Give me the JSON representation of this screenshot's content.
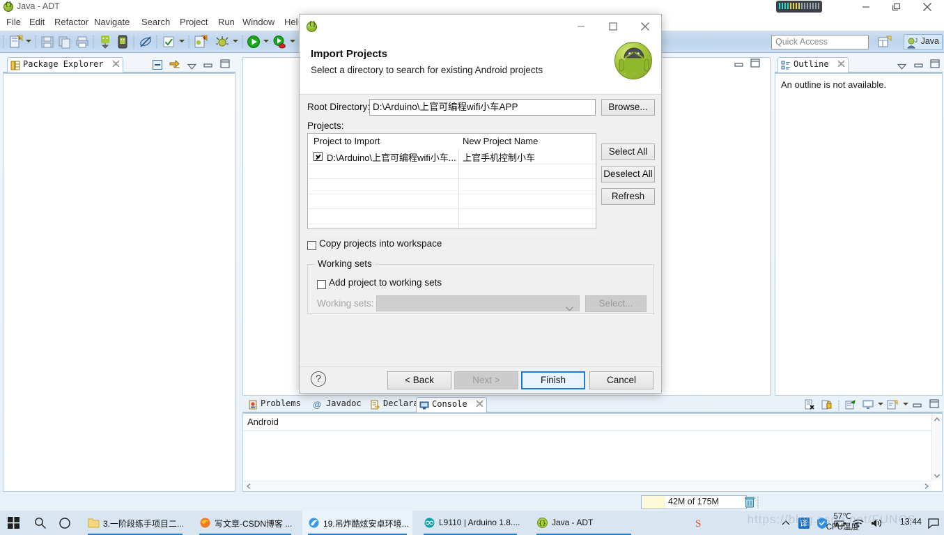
{
  "eclipse": {
    "window_title": "Java - ADT",
    "window_icon": "eclipse-icon",
    "menu": [
      "File",
      "Edit",
      "Refactor",
      "Navigate",
      "Search",
      "Project",
      "Run",
      "Window",
      "Hel"
    ],
    "quick_access_placeholder": "Quick Access",
    "perspective_label": "Java",
    "toolbar_icons": [
      "new-file-icon",
      "dropdown-arrow",
      "save-icon",
      "copy-icon",
      "print-icon",
      "android-sdk-manager-icon",
      "android-avd-manager-icon",
      "link-break-icon",
      "checkmark-icon",
      "dropdown-arrow",
      "new-android-project-icon",
      "debug-icon",
      "dropdown-arrow",
      "run-icon",
      "dropdown-arrow",
      "run-external-tools-icon",
      "dropdown-arrow",
      "new-window-icon"
    ]
  },
  "package_explorer": {
    "tab_label": "Package Explorer",
    "tab_icon": "package-explorer-icon",
    "close_icon": "close-icon",
    "toolbar_icons": [
      "collapse-all-icon",
      "link-with-editor-icon",
      "view-menu-icon",
      "minimize-icon",
      "maximize-icon"
    ]
  },
  "outline": {
    "tab_label": "Outline",
    "tab_icon": "outline-icon",
    "close_icon": "close-icon",
    "message": "An outline is not available.",
    "toolbar_icons": [
      "view-menu-icon",
      "minimize-icon",
      "maximize-icon"
    ]
  },
  "console": {
    "tabs": [
      {
        "label": "Problems",
        "icon": "problems-icon",
        "active": false
      },
      {
        "label": "Javadoc",
        "icon": "javadoc-at-icon",
        "active": false
      },
      {
        "label": "Declaration",
        "icon": "declaration-icon",
        "active": false
      },
      {
        "label": "Console",
        "icon": "console-icon",
        "active": true
      }
    ],
    "close_icon": "close-icon",
    "content": "Android",
    "toolbar_icons": [
      "clear-console-icon",
      "lock-scroll-icon",
      "pin-console-icon",
      "display-selected-console-icon",
      "dropdown-arrow",
      "open-console-icon",
      "dropdown-arrow",
      "minimize-icon",
      "maximize-icon"
    ]
  },
  "status_bar": {
    "heap_text": "42M of 175M",
    "trash_icon": "trash-icon"
  },
  "dialog": {
    "window_icon": "eclipse-icon",
    "title": "Import Projects",
    "subtitle": "Select a directory to search for existing Android projects",
    "brand_icon": "android-robot-icon",
    "titlebar_buttons": [
      "minimize-icon",
      "maximize-icon",
      "close-icon"
    ],
    "root_directory": {
      "label": "Root Directory:",
      "value": "D:\\Arduino\\上官可编程wifi小车APP",
      "browse_label": "Browse..."
    },
    "projects_label": "Projects:",
    "table": {
      "columns": [
        "Project to Import",
        "New Project Name"
      ],
      "rows": [
        {
          "checked": true,
          "project": "D:\\Arduino\\上官可编程wifi小车...",
          "new_name": "上官手机控制小车"
        }
      ],
      "empty_rows": 5
    },
    "side_buttons": [
      {
        "label": "Select All",
        "enabled": true
      },
      {
        "label": "Deselect All",
        "enabled": true
      },
      {
        "label": "Refresh",
        "enabled": true
      }
    ],
    "copy_projects": {
      "label": "Copy projects into workspace",
      "checked": false
    },
    "working_sets": {
      "legend": "Working sets",
      "add_label": "Add project to working sets",
      "add_checked": false,
      "combo_label": "Working sets:",
      "combo_value": "",
      "select_label": "Select...",
      "enabled": false
    },
    "help_icon": "help-icon",
    "footer_buttons": [
      {
        "label": "< Back",
        "state": "enabled"
      },
      {
        "label": "Next >",
        "state": "disabled"
      },
      {
        "label": "Finish",
        "state": "default"
      },
      {
        "label": "Cancel",
        "state": "enabled"
      }
    ]
  },
  "taskbar": {
    "start_icon": "windows-start-icon",
    "search_icon": "search-icon",
    "taskview_icon": "task-view-icon",
    "items": [
      {
        "label": "3.一阶段练手项目二...",
        "icon": "folder-icon",
        "active": false
      },
      {
        "label": "写文章-CSDN博客 ...",
        "icon": "firefox-icon",
        "active": false
      },
      {
        "label": "19.吊炸酷炫安卓环境...",
        "icon": "browser-icon",
        "active": true
      },
      {
        "label": "L9110 | Arduino 1.8....",
        "icon": "arduino-icon",
        "active": false
      },
      {
        "label": "Java - ADT",
        "icon": "eclipse-icon",
        "active": false
      }
    ],
    "tray": {
      "sogou_icon": "sogou-input-icon",
      "temperature": "57℃",
      "temperature_label": "CPU温度",
      "icons": [
        "chevron-up-icon",
        "translate-icon",
        "shield-icon",
        "usb-icon",
        "wifi-icon",
        "volume-icon"
      ],
      "clock": "13:44",
      "notification_icon": "notification-icon"
    },
    "watermark": "https://blog.csdn.net/FUNCS"
  }
}
